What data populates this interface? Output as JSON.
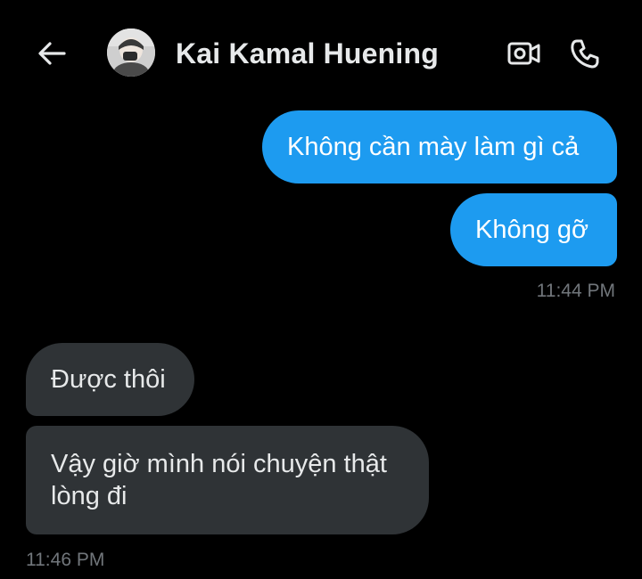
{
  "header": {
    "back_icon": "arrow-left-icon",
    "avatar_icon": "profile-photo",
    "contact_name": "Kai Kamal Huening",
    "video_icon": "video-camera-icon",
    "call_icon": "phone-icon"
  },
  "colors": {
    "background": "#000000",
    "outgoing_bubble": "#1d9bf0",
    "incoming_bubble": "#2f3336",
    "text_primary": "#e7e9ea",
    "timestamp": "#71767b"
  },
  "messages": [
    {
      "direction": "outgoing",
      "text": "Không cần mày làm gì cả"
    },
    {
      "direction": "outgoing",
      "text": "Không gỡ"
    },
    {
      "direction": "incoming",
      "text": "Được thôi"
    },
    {
      "direction": "incoming",
      "text": "Vậy giờ mình nói chuyện thật lòng đi"
    }
  ],
  "timestamps": {
    "outgoing_group": "11:44 PM",
    "incoming_group": "11:46 PM"
  }
}
